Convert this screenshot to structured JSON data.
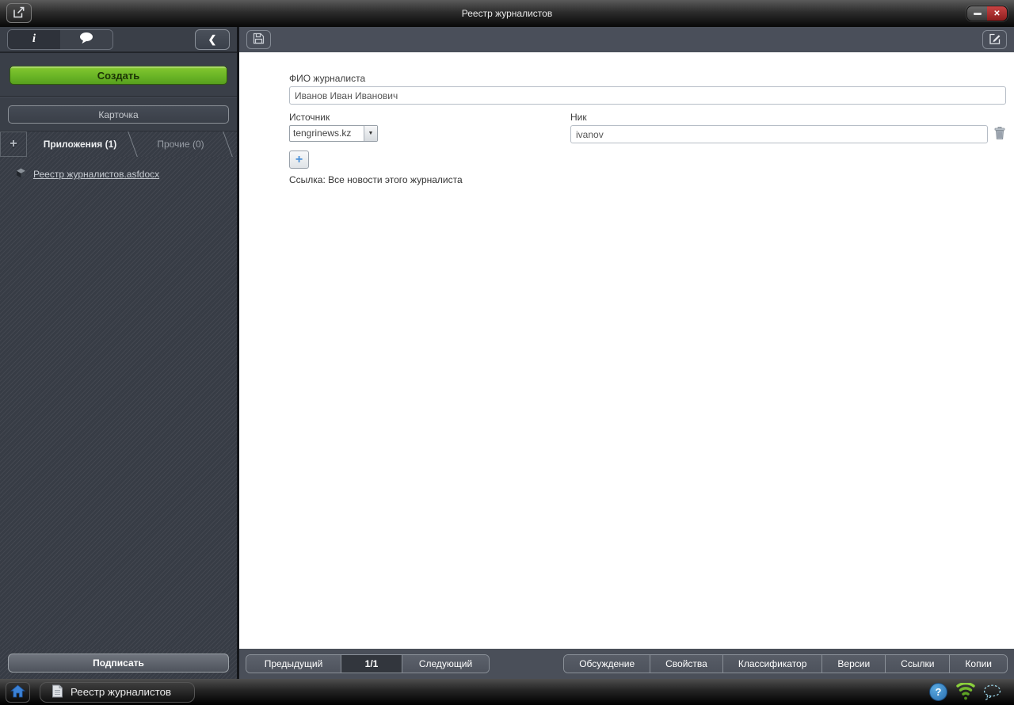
{
  "window": {
    "title": "Реестр журналистов"
  },
  "icons": {
    "minimize": "–",
    "close": "✕",
    "collapse": "❮",
    "info": "i",
    "add_tab": "+",
    "add_row": "+",
    "dropdown_arrow": "▼"
  },
  "sidebar": {
    "create_button": "Создать",
    "card_button": "Карточка",
    "tabs": [
      {
        "label": "Приложения (1)",
        "active": true
      },
      {
        "label": "Прочие (0)",
        "active": false
      }
    ],
    "attachment_link": "Реестр журналистов.asfdocx",
    "sign_button": "Подписать"
  },
  "form": {
    "fio_label": "ФИО журналиста",
    "fio_value": "Иванов Иван Иванович",
    "source_label": "Источник",
    "source_value": "tengrinews.kz",
    "nick_label": "Ник",
    "nick_value": "ivanov",
    "link_text": "Ссылка: Все новости этого журналиста"
  },
  "pagination": {
    "prev": "Предыдущий",
    "counter": "1/1",
    "next": "Следующий"
  },
  "bottom_tabs": [
    "Обсуждение",
    "Свойства",
    "Классификатор",
    "Версии",
    "Ссылки",
    "Копии"
  ],
  "taskbar": {
    "task_label": "Реестр журналистов",
    "help": "?"
  },
  "colors": {
    "accent_green": "#6ab526",
    "close_red": "#a32828",
    "link_blue": "#4a90d9",
    "toolbar_slate": "#4a4f5a"
  }
}
